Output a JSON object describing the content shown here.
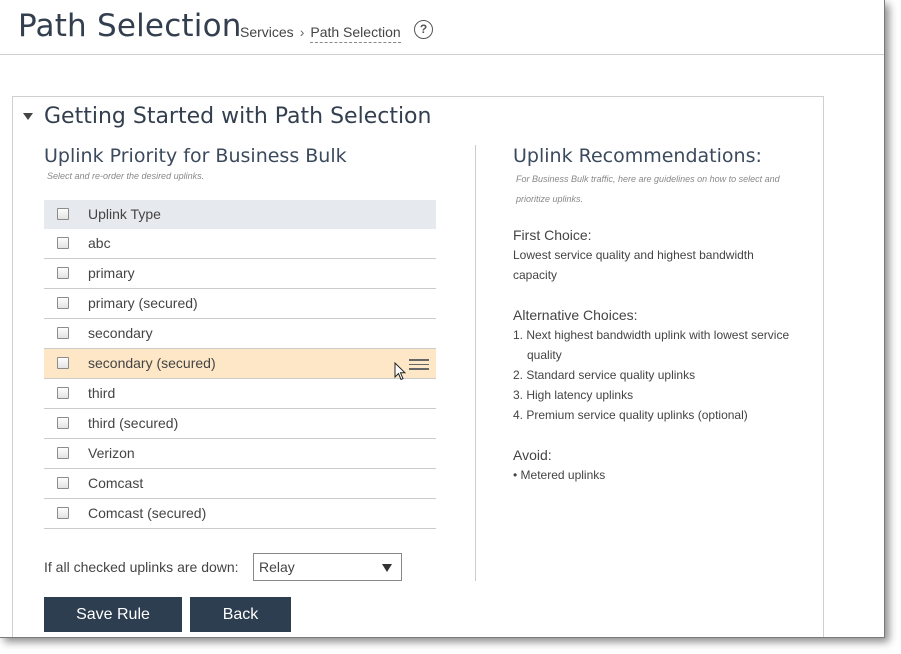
{
  "header": {
    "page_title": "Path Selection",
    "breadcrumb": {
      "parent": "Services",
      "separator": "›",
      "current": "Path Selection"
    },
    "help_glyph": "?"
  },
  "panel": {
    "title": "Getting Started with Path Selection",
    "left": {
      "title": "Uplink Priority for Business Bulk",
      "subtitle": "Select and re-order the desired uplinks.",
      "header_label": "Uplink Type",
      "rows": [
        {
          "label": "abc",
          "checked": false
        },
        {
          "label": "primary",
          "checked": false
        },
        {
          "label": "primary (secured)",
          "checked": false
        },
        {
          "label": "secondary",
          "checked": false
        },
        {
          "label": "secondary (secured)",
          "checked": false,
          "highlighted": true
        },
        {
          "label": "third",
          "checked": false
        },
        {
          "label": "third (secured)",
          "checked": false
        },
        {
          "label": "Verizon",
          "checked": false
        },
        {
          "label": "Comcast",
          "checked": false
        },
        {
          "label": "Comcast (secured)",
          "checked": false
        }
      ],
      "down_label": "If all checked uplinks are down:",
      "down_select_value": "Relay",
      "save_label": "Save Rule",
      "back_label": "Back"
    },
    "right": {
      "title": "Uplink Recommendations:",
      "subtitle": "For Business Bulk traffic, here are guidelines on how to select and prioritize uplinks.",
      "first_heading": "First Choice:",
      "first_line1": "Lowest service quality and highest bandwidth",
      "first_line2": "capacity",
      "alt_heading": "Alternative Choices:",
      "alt_1a": "1. Next highest bandwidth uplink with lowest service",
      "alt_1b": "quality",
      "alt_2": "2. Standard service quality uplinks",
      "alt_3": "3. High latency uplinks",
      "alt_4": "4. Premium service quality uplinks (optional)",
      "avoid_heading": "Avoid:",
      "avoid_1": "• Metered uplinks"
    }
  },
  "colors": {
    "button": "#2d3e50",
    "highlight_row": "#fde7c7",
    "table_header": "#e6e9ee"
  }
}
